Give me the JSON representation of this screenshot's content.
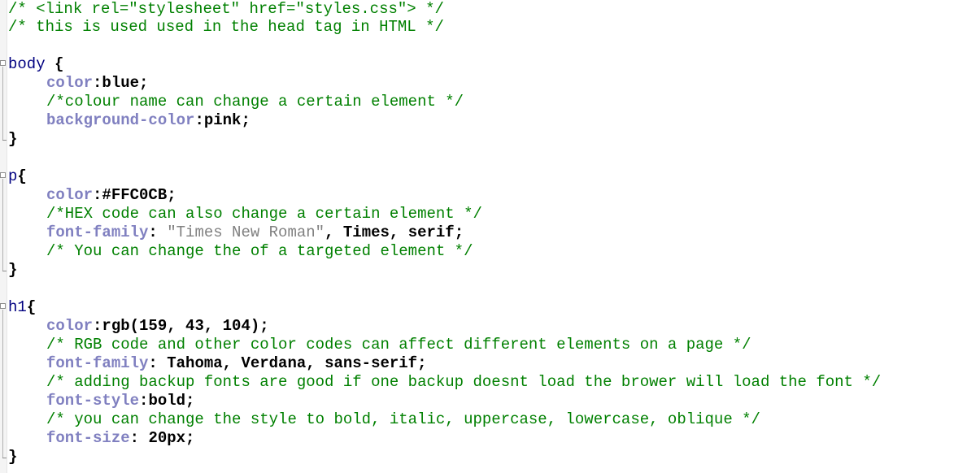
{
  "editor": {
    "lines": {
      "l1": "/* <link rel=\"stylesheet\" href=\"styles.css\"> */",
      "l2": "/* this is used used in the head tag in HTML */",
      "body_sel": "body",
      "body_open": " {",
      "body_color_prop": "color",
      "body_color_val": "blue",
      "body_cmt": "/*colour name can change a certain element */",
      "body_bg_prop": "background-color",
      "body_bg_val": "pink",
      "p_sel": "p",
      "p_color_prop": "color",
      "p_color_val": "#FFC0CB",
      "p_cmt1": "/*HEX code can also change a certain element */",
      "p_ff_prop": "font-family",
      "p_ff_str": "\"Times New Roman\"",
      "p_ff_rest": "Times, serif",
      "p_cmt2": "/* You can change the of a targeted element */",
      "h1_sel": "h1",
      "h1_color_prop": "color",
      "h1_color_val": "rgb(159, 43, 104)",
      "h1_cmt1": "/* RGB code and other color codes can affect different elements on a page */",
      "h1_ff_prop": "font-family",
      "h1_ff_val": "Tahoma, Verdana, sans-serif",
      "h1_cmt2": "/* adding backup fonts are good if one backup doesnt load the brower will load the font */",
      "h1_fs_prop": "font-style",
      "h1_fs_val": "bold",
      "h1_cmt3": "/* you can change the style to bold, italic, uppercase, lowercase, oblique */",
      "h1_size_prop": "font-size",
      "h1_size_val": "20px",
      "brace_open": "{",
      "brace_close": "}",
      "colon": ":",
      "colon_space": ": ",
      "semicolon": ";",
      "comma_space": ", "
    },
    "colors": {
      "comment": "#008000",
      "selector": "#000080",
      "property": "#8080c0",
      "string": "#808080"
    }
  }
}
